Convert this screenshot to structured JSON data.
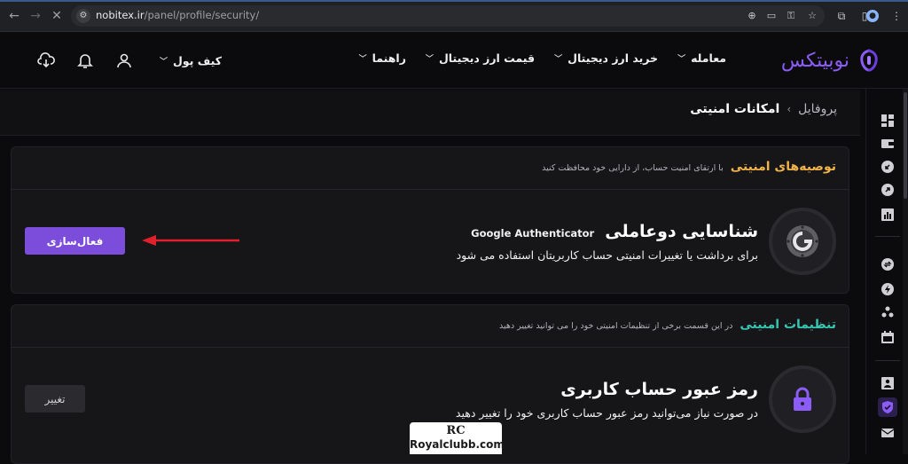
{
  "browser": {
    "url_host": "nobitex.ir",
    "url_path": "/panel/profile/security/"
  },
  "header": {
    "logo_text": "نوبیتکس",
    "menu": [
      {
        "label": "معامله"
      },
      {
        "label": "خرید ارز دیجیتال"
      },
      {
        "label": "قیمت ارز دیجیتال"
      },
      {
        "label": "راهنما"
      }
    ],
    "wallet_label": "کیف پول"
  },
  "breadcrumb": {
    "root": "پروفایل",
    "separator": "›",
    "current": "امکانات امنیتی"
  },
  "recommendations": {
    "title": "توصیه‌های امنیتی",
    "subtitle": "با ارتقای امنیت حساب، از دارایی خود محافظت کنید",
    "title_color": "#f0b24a",
    "item": {
      "title": "شناسایی دوعاملی",
      "tag": "Google Authenticator",
      "description": "برای برداشت یا تغییرات امنیتی حساب کاربریتان استفاده می شود",
      "button_label": "فعال‌سازی",
      "icon": "google-authenticator-icon"
    }
  },
  "settings": {
    "title": "تنظیمات امنیتی",
    "subtitle": "در این قسمت برخی از تنظیمات امنیتی خود را می توانید تغییر دهید",
    "title_color": "#36c7b3",
    "item": {
      "title": "رمز عبور حساب کاربری",
      "description": "در صورت نیاز می‌توانید رمز عبور حساب کاربری خود را تغییر دهید",
      "button_label": "تغییر",
      "icon": "lock-icon"
    }
  },
  "watermark": {
    "mark": "RC",
    "text": "Royalclubb.com"
  },
  "colors": {
    "accent": "#7c4ddb",
    "arrow": "#e0202a"
  }
}
